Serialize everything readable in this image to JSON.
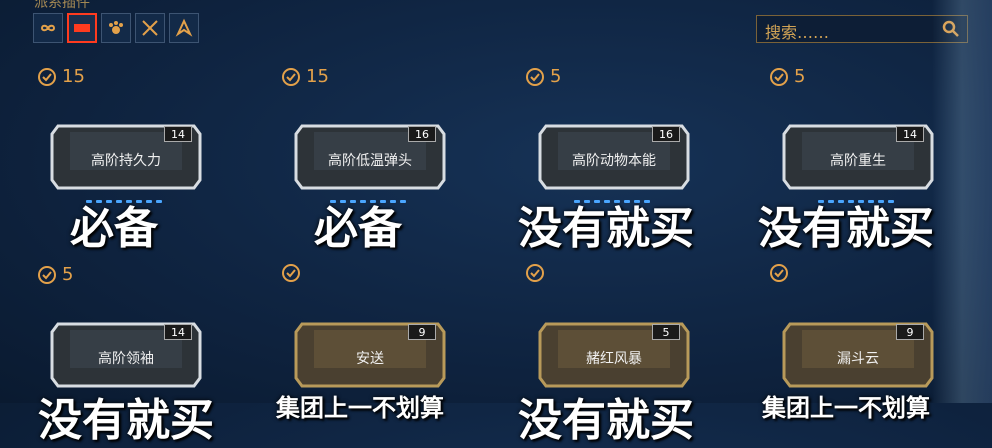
{
  "header": {
    "title": "派系插件",
    "search_placeholder": "搜索……",
    "filters": [
      {
        "name": "filter-all",
        "active": false
      },
      {
        "name": "filter-warframe",
        "active": true
      },
      {
        "name": "filter-companion",
        "active": false
      },
      {
        "name": "filter-melee",
        "active": false
      },
      {
        "name": "filter-archwing",
        "active": false
      }
    ]
  },
  "mods": [
    {
      "count": "15",
      "name": "高阶持久力",
      "rank": "14",
      "tier": "silver",
      "verdict": "必备"
    },
    {
      "count": "15",
      "name": "高阶低温弹头",
      "rank": "16",
      "tier": "silver",
      "verdict": "必备"
    },
    {
      "count": "5",
      "name": "高阶动物本能",
      "rank": "16",
      "tier": "silver",
      "verdict": "没有就买"
    },
    {
      "count": "5",
      "name": "高阶重生",
      "rank": "14",
      "tier": "silver",
      "verdict": "没有就买"
    },
    {
      "count": "5",
      "name": "高阶领袖",
      "rank": "14",
      "tier": "silver",
      "verdict": "没有就买"
    },
    {
      "count": "",
      "name": "安送",
      "rank": "9",
      "tier": "gold",
      "verdict": "集团上一不划算"
    },
    {
      "count": "",
      "name": "赭红风暴",
      "rank": "5",
      "tier": "gold",
      "verdict": "没有就买"
    },
    {
      "count": "",
      "name": "漏斗云",
      "rank": "9",
      "tier": "gold",
      "verdict": "集团上一不划算"
    }
  ],
  "colors": {
    "accent": "#e3a14a",
    "active_filter": "#ff3b1f",
    "silver": "#d8dde2",
    "gold": "#b89a5a"
  }
}
